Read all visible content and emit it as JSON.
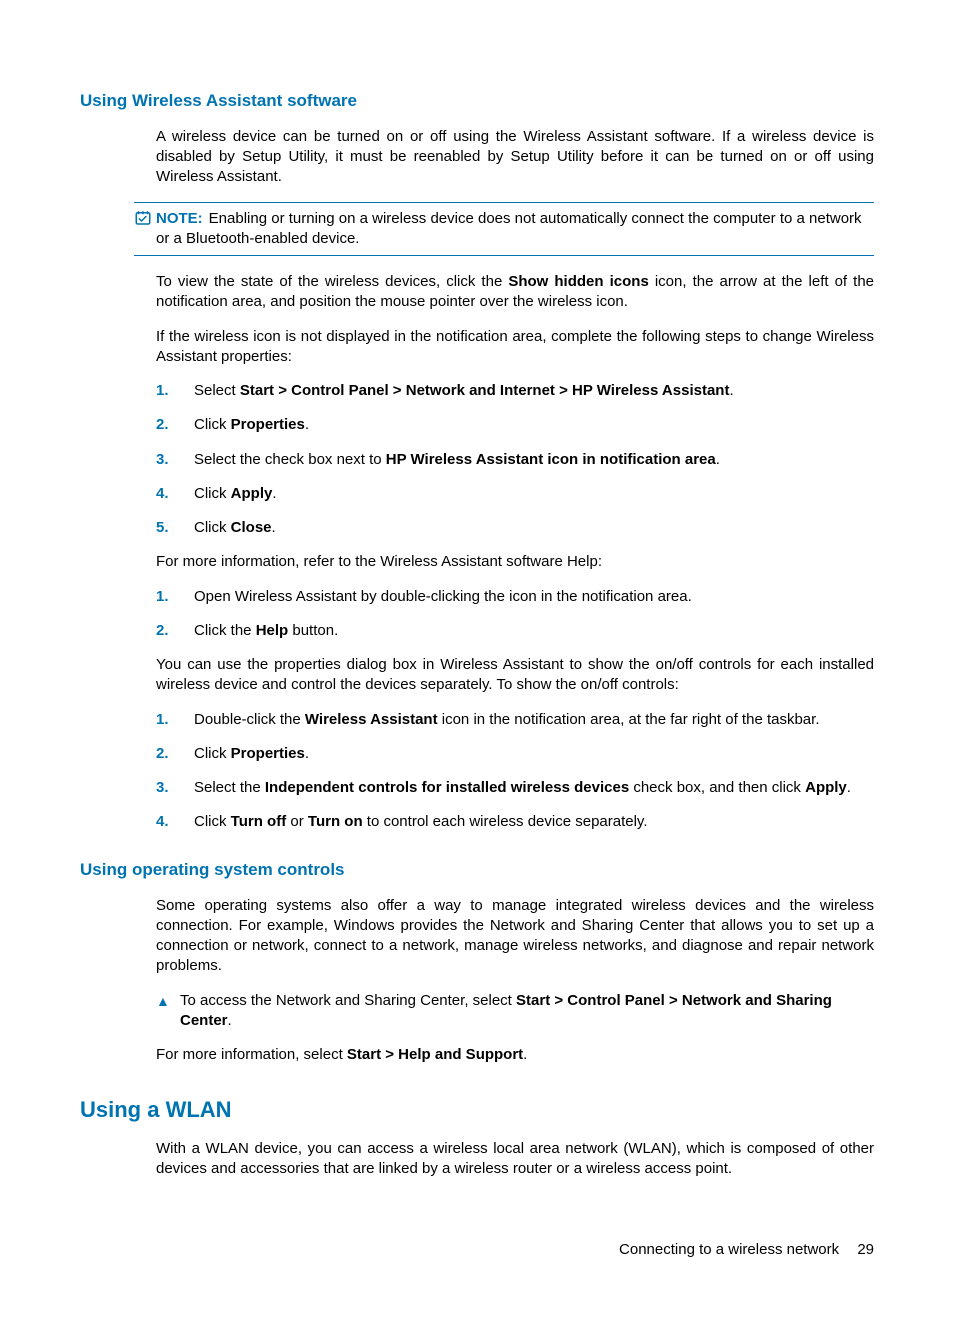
{
  "section1": {
    "heading": "Using Wireless Assistant software",
    "para1": "A wireless device can be turned on or off using the Wireless Assistant software. If a wireless device is disabled by Setup Utility, it must be reenabled by Setup Utility before it can be turned on or off using Wireless Assistant.",
    "note_label": "NOTE:",
    "note_text": "Enabling or turning on a wireless device does not automatically connect the computer to a network or a Bluetooth-enabled device.",
    "para2_pre": "To view the state of the wireless devices, click the ",
    "para2_bold": "Show hidden icons",
    "para2_post": " icon, the arrow at the left of the notification area, and position the mouse pointer over the wireless icon.",
    "para3": "If the wireless icon is not displayed in the notification area, complete the following steps to change Wireless Assistant properties:",
    "list1": {
      "i1_pre": "Select ",
      "i1_bold": "Start > Control Panel > Network and Internet > HP Wireless Assistant",
      "i1_post": ".",
      "i2_pre": "Click ",
      "i2_bold": "Properties",
      "i2_post": ".",
      "i3_pre": "Select the check box next to ",
      "i3_bold": "HP Wireless Assistant icon in notification area",
      "i3_post": ".",
      "i4_pre": "Click ",
      "i4_bold": "Apply",
      "i4_post": ".",
      "i5_pre": "Click ",
      "i5_bold": "Close",
      "i5_post": "."
    },
    "para4": "For more information, refer to the Wireless Assistant software Help:",
    "list2": {
      "i1": "Open Wireless Assistant by double-clicking the icon in the notification area.",
      "i2_pre": "Click the ",
      "i2_bold": "Help",
      "i2_post": " button."
    },
    "para5": "You can use the properties dialog box in Wireless Assistant to show the on/off controls for each installed wireless device and control the devices separately. To show the on/off controls:",
    "list3": {
      "i1_pre": "Double-click the ",
      "i1_bold": "Wireless Assistant",
      "i1_post": " icon in the notification area, at the far right of the taskbar.",
      "i2_pre": "Click ",
      "i2_bold": "Properties",
      "i2_post": ".",
      "i3_pre": "Select the ",
      "i3_bold": "Independent controls for installed wireless devices",
      "i3_mid": " check box, and then click ",
      "i3_bold2": "Apply",
      "i3_post": ".",
      "i4_pre": "Click ",
      "i4_bold": "Turn off",
      "i4_mid": " or ",
      "i4_bold2": "Turn on",
      "i4_post": " to control each wireless device separately."
    }
  },
  "section2": {
    "heading": "Using operating system controls",
    "para1": "Some operating systems also offer a way to manage integrated wireless devices and the wireless connection. For example, Windows provides the Network and Sharing Center that allows you to set up a connection or network, connect to a network, manage wireless networks, and diagnose and repair network problems.",
    "bullet_pre": "To access the Network and Sharing Center, select ",
    "bullet_bold": "Start > Control Panel > Network and Sharing Center",
    "bullet_post": ".",
    "para2_pre": "For more information, select ",
    "para2_bold": "Start > Help and Support",
    "para2_post": "."
  },
  "section3": {
    "heading": "Using a WLAN",
    "para1": "With a WLAN device, you can access a wireless local area network (WLAN), which is composed of other devices and accessories that are linked by a wireless router or a wireless access point."
  },
  "footer": {
    "text": "Connecting to a wireless network",
    "page": "29"
  }
}
